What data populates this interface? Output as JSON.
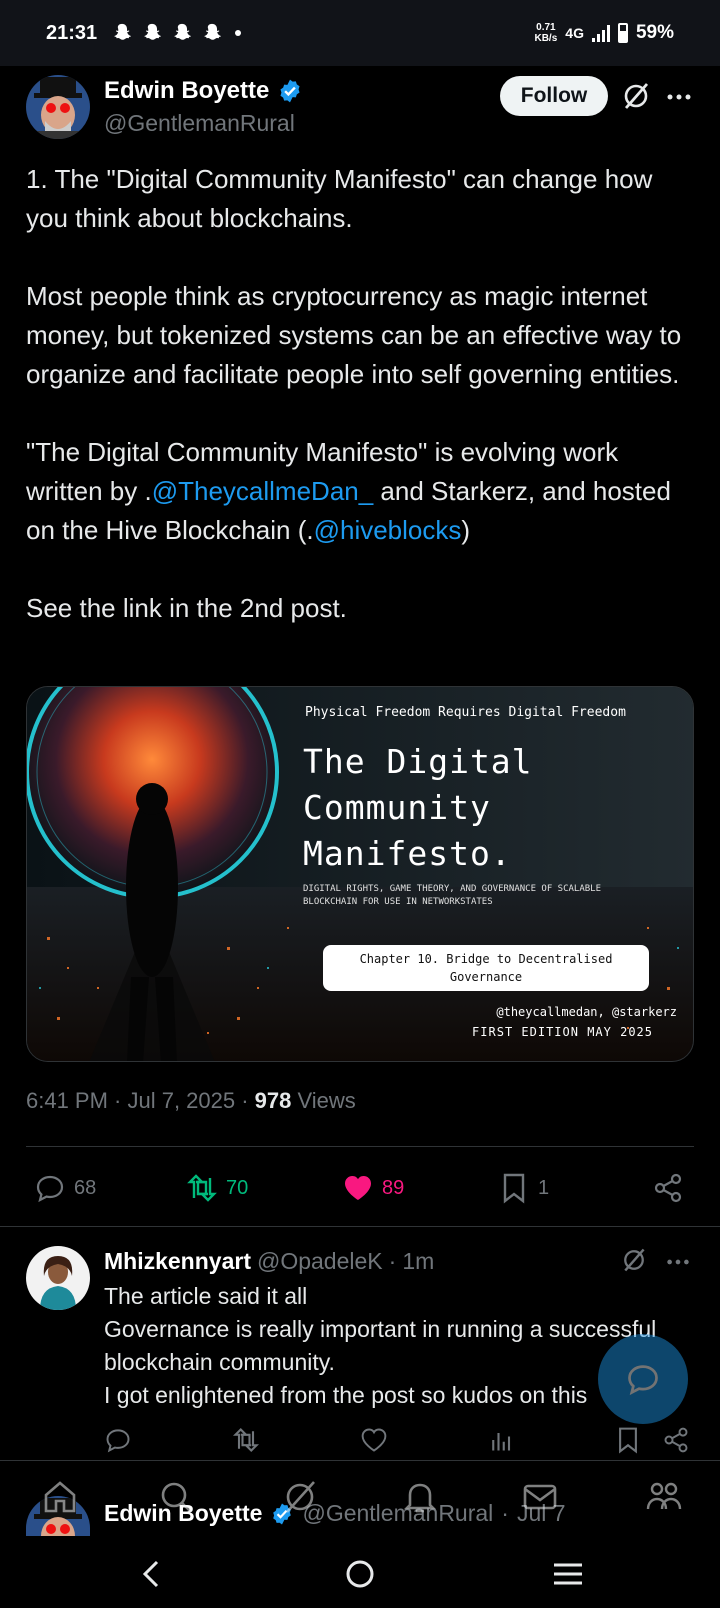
{
  "status_bar": {
    "time": "21:31",
    "net_speed_value": "0.71",
    "net_speed_unit": "KB/s",
    "network": "4G",
    "battery": "59%"
  },
  "post": {
    "author_name": "Edwin Boyette",
    "author_handle": "@GentlemanRural",
    "follow_label": "Follow",
    "paragraphs": {
      "p1": "1. The \"Digital Community Manifesto\" can change how you think about blockchains.",
      "p2": "Most people think as cryptocurrency as magic internet money, but tokenized systems can be an effective way to organize and facilitate people into self governing entities.",
      "p3_a": "\"The Digital Community Manifesto\" is evolving work written by .",
      "p3_mention1": "@TheycallmeDan_",
      "p3_b": " and Starkerz, and hosted on the Hive Blockchain (.",
      "p3_mention2": "@hiveblocks",
      "p3_c": ")",
      "p4": "See the link in the 2nd post."
    },
    "media": {
      "top_line": "Physical Freedom Requires Digital Freedom",
      "title_l1": "The Digital",
      "title_l2": "Community",
      "title_l3": "Manifesto.",
      "subtitle_l1": "DIGITAL RIGHTS, GAME THEORY, AND GOVERNANCE OF SCALABLE",
      "subtitle_l2": "BLOCKCHAIN FOR USE IN NETWORKSTATES",
      "chapter_l1": "Chapter 10. Bridge to Decentralised",
      "chapter_l2": "Governance",
      "authors": "@theycallmedan, @starkerz",
      "edition": "FIRST EDITION MAY 2025"
    },
    "meta": {
      "time_date": "6:41 PM · Jul 7, 2025 · ",
      "views_count": "978",
      "views_label": " Views"
    },
    "actions": {
      "replies": "68",
      "reposts": "70",
      "likes": "89",
      "bookmarks": "1"
    }
  },
  "reply": {
    "name": "Mhizkennyart",
    "handle": "@OpadeleK",
    "sep": "·",
    "time": "1m",
    "lines": {
      "l1": "The article said it all",
      "l2": "Governance is really important in running a successful blockchain community.",
      "l3": "I got enlightened from the post so kudos on this"
    }
  },
  "peek_post": {
    "name": "Edwin Boyette",
    "handle": "@GentlemanRural",
    "sep": "·",
    "date": "Jul 7"
  },
  "colors": {
    "accent": "#1d9bf0",
    "repost": "#00ba7c",
    "like": "#f91880"
  }
}
